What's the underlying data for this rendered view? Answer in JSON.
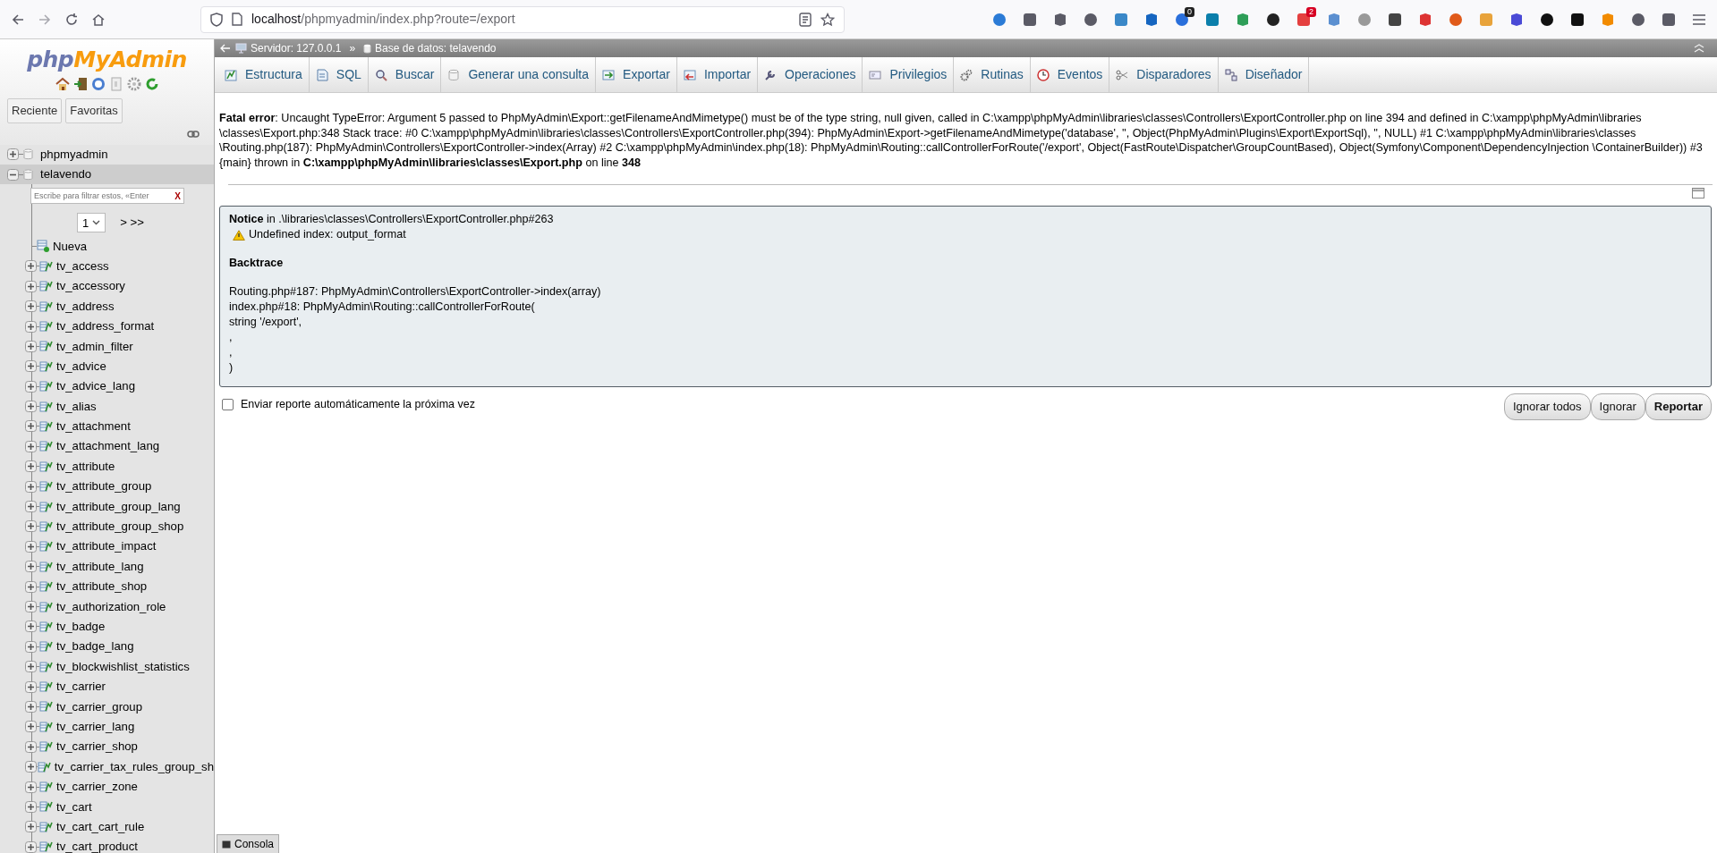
{
  "browser": {
    "url_host": "localhost",
    "url_path": "/phpmyadmin/index.php?route=/export",
    "extension_badges": [
      "0",
      "2"
    ]
  },
  "sidebar": {
    "logo": [
      "php",
      "MyAdmin"
    ],
    "buttons": [
      "Reciente",
      "Favoritas"
    ],
    "databases": [
      {
        "name": "phpmyadmin",
        "expanded": false,
        "selected": false
      },
      {
        "name": "telavendo",
        "expanded": true,
        "selected": true,
        "filter": {
          "placeholder": "Escribe para filtrar estos, «Enter"
        },
        "clear": "X",
        "page": "1",
        "pager": "> >>",
        "new_label": "Nueva",
        "children": [
          {
            "name": "tv_access"
          },
          {
            "name": "tv_accessory"
          },
          {
            "name": "tv_address"
          },
          {
            "name": "tv_address_format"
          },
          {
            "name": "tv_admin_filter"
          },
          {
            "name": "tv_advice"
          },
          {
            "name": "tv_advice_lang"
          },
          {
            "name": "tv_alias"
          },
          {
            "name": "tv_attachment"
          },
          {
            "name": "tv_attachment_lang"
          },
          {
            "name": "tv_attribute"
          },
          {
            "name": "tv_attribute_group"
          },
          {
            "name": "tv_attribute_group_lang"
          },
          {
            "name": "tv_attribute_group_shop"
          },
          {
            "name": "tv_attribute_impact"
          },
          {
            "name": "tv_attribute_lang"
          },
          {
            "name": "tv_attribute_shop"
          },
          {
            "name": "tv_authorization_role"
          },
          {
            "name": "tv_badge"
          },
          {
            "name": "tv_badge_lang"
          },
          {
            "name": "tv_blockwishlist_statistics"
          },
          {
            "name": "tv_carrier"
          },
          {
            "name": "tv_carrier_group"
          },
          {
            "name": "tv_carrier_lang"
          },
          {
            "name": "tv_carrier_shop"
          },
          {
            "name": "tv_carrier_tax_rules_group_sh"
          },
          {
            "name": "tv_carrier_zone"
          },
          {
            "name": "tv_cart"
          },
          {
            "name": "tv_cart_cart_rule"
          },
          {
            "name": "tv_cart_product"
          }
        ]
      }
    ]
  },
  "breadcrumb": {
    "server": "Servidor: 127.0.0.1",
    "separator": "»",
    "database": "Base de datos: telavendo"
  },
  "tabs": [
    {
      "label": "Estructura",
      "selected": false
    },
    {
      "label": "SQL",
      "selected": false
    },
    {
      "label": "Buscar",
      "selected": false
    },
    {
      "label": "Generar una consulta",
      "selected": false
    },
    {
      "label": "Exportar",
      "selected": false
    },
    {
      "label": "Importar",
      "selected": false
    },
    {
      "label": "Operaciones",
      "selected": false
    },
    {
      "label": "Privilegios",
      "selected": false
    },
    {
      "label": "Rutinas",
      "selected": false
    },
    {
      "label": "Eventos",
      "selected": false
    },
    {
      "label": "Disparadores",
      "selected": false
    },
    {
      "label": "Diseñador",
      "selected": false
    }
  ],
  "fatal_error": "**Fatal error**: Uncaught TypeError: Argument 5 passed to PhpMyAdmin\\Export::getFilenameAndMimetype() must be of the type string, null given, called in C:\\xampp\\phpMyAdmin\\libraries\\classes\\Controllers\\ExportController.php on line 394 and defined in C:\\xampp\\phpMyAdmin\\libraries \\classes\\Export.php:348 Stack trace: #0 C:\\xampp\\phpMyAdmin\\libraries\\classes\\Controllers\\ExportController.php(394): PhpMyAdmin\\Export->getFilenameAndMimetype('database', '', Object(PhpMyAdmin\\Plugins\\Export\\ExportSql), '', NULL) #1 C:\\xampp\\phpMyAdmin\\libraries\\classes \\Routing.php(187): PhpMyAdmin\\Controllers\\ExportController->index(Array) #2 C:\\xampp\\phpMyAdmin\\index.php(18): PhpMyAdmin\\Routing::callControllerForRoute('/export', Object(FastRoute\\Dispatcher\\GroupCountBased), Object(Symfony\\Component\\DependencyInjection \\ContainerBuilder)) #3 {main} thrown in **C:\\xampp\\phpMyAdmin\\libraries\\classes\\Export.php** on line **348**",
  "notice": {
    "heading": "**Notice** in .\\libraries\\classes\\Controllers\\ExportController.php#263",
    "message": "Undefined index: output_format",
    "backtrace_title": "Backtrace",
    "lines": [
      "Routing.php#187: PhpMyAdmin\\Controllers\\ExportController->index(array)",
      "index.php#18: PhpMyAdmin\\Routing::callControllerForRoute(",
      "string '/export',",
      ",",
      ",",
      ")"
    ]
  },
  "report": {
    "label": "Enviar reporte automáticamente la próxima vez",
    "checked": false
  },
  "buttons": [
    {
      "label": "Ignorar todos",
      "primary": false
    },
    {
      "label": "Ignorar",
      "primary": false
    },
    {
      "label": "Reportar",
      "primary": true
    }
  ],
  "console": "Consola"
}
